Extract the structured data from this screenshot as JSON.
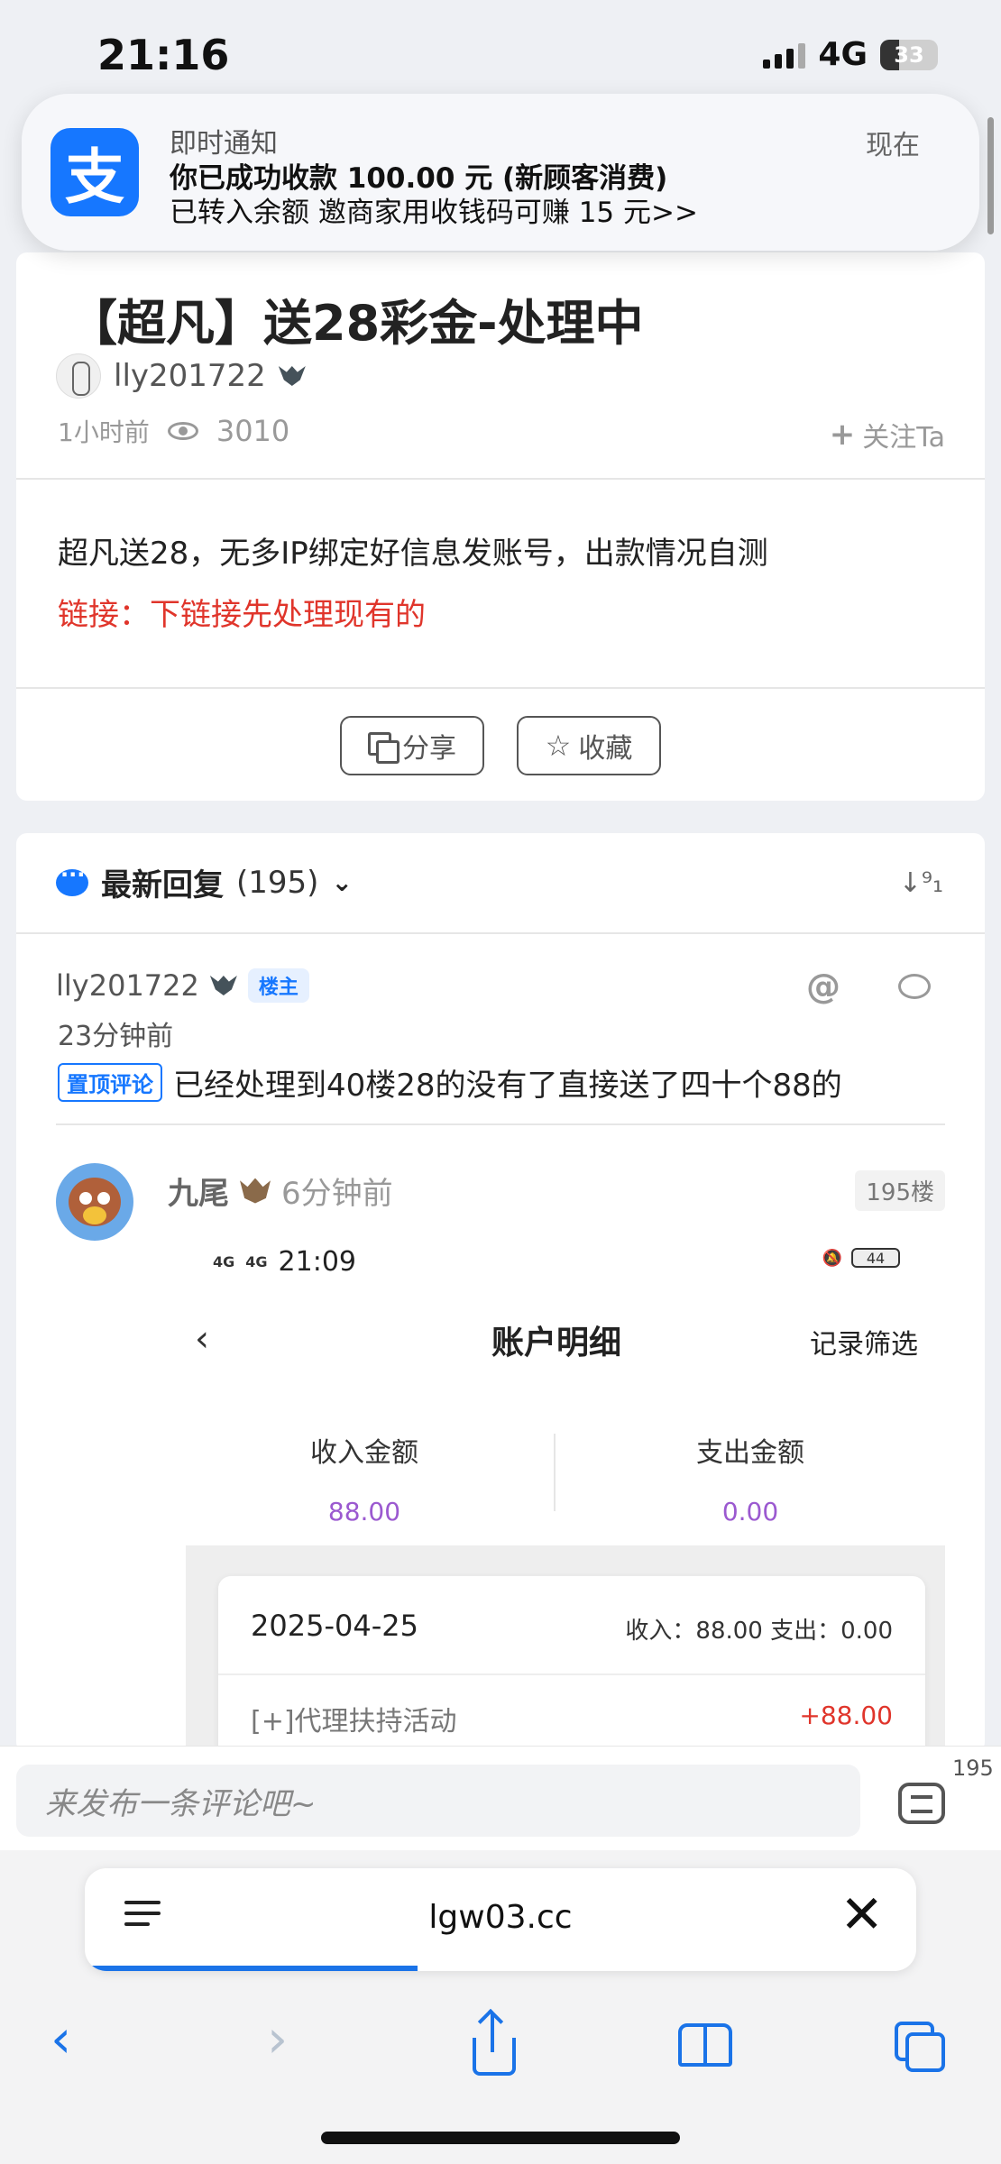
{
  "status_bar": {
    "time": "21:16",
    "network": "4G",
    "battery": "33"
  },
  "notification": {
    "app_icon": "alipay-icon",
    "app_glyph": "支",
    "title": "即时通知",
    "line1": "你已成功收款 100.00 元 (新顾客消费)",
    "line2": "已转入余额 邀商家用收钱码可赚 15 元>>",
    "time": "现在"
  },
  "post": {
    "title": "【超凡】送28彩金-处理中",
    "author": "lly201722",
    "time": "1小时前",
    "views": "3010",
    "follow_label": "关注Ta",
    "body": "超凡送28，无多IP绑定好信息发账号，出款情况自测",
    "link_text": "链接：下链接先处理现有的",
    "share_label": "分享",
    "favorite_label": "收藏"
  },
  "replies": {
    "header": "最新回复",
    "count": "(195)",
    "sort_icon": "↓⁹₁",
    "reply1": {
      "author": "lly201722",
      "owner_tag": "楼主",
      "time": "23分钟前",
      "pin_tag": "置顶评论",
      "text": "已经处理到40楼28的没有了直接送了四十个88的"
    },
    "reply2": {
      "author": "九尾",
      "time": "6分钟前",
      "floor": "195楼",
      "screenshot": {
        "signal": "4G",
        "time": "21:09",
        "battery": "44",
        "title": "账户明细",
        "filter": "记录筛选",
        "income_label": "收入金额",
        "income_value": "88.00",
        "expense_label": "支出金额",
        "expense_value": "0.00",
        "record_date": "2025-04-25",
        "record_summary": "收入：88.00 支出：0.00",
        "record_item": "[+]代理扶持活动",
        "record_amount": "+88.00"
      }
    }
  },
  "comment_bar": {
    "placeholder": "来发布一条评论吧~",
    "count": "195"
  },
  "browser": {
    "url": "lgw03.cc",
    "close_glyph": "✕",
    "back_glyph": "‹",
    "forward_glyph": "›",
    "load_progress": 0.4
  }
}
